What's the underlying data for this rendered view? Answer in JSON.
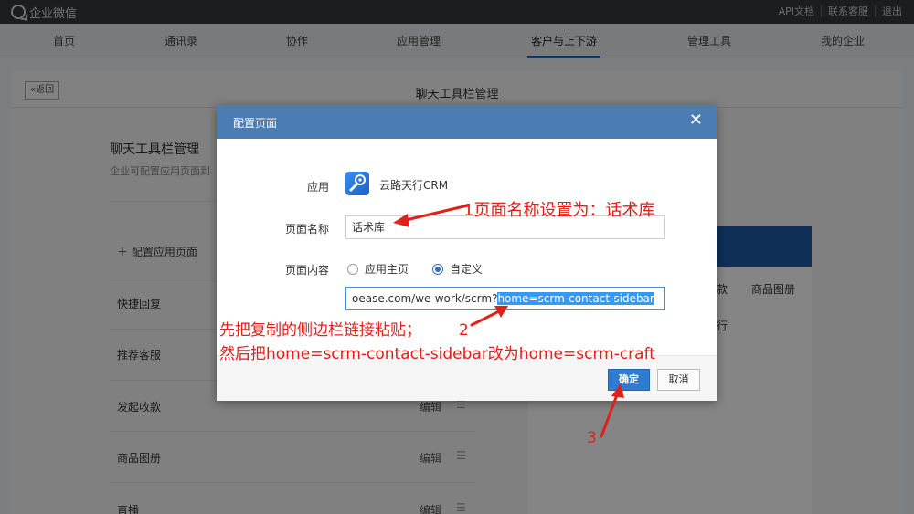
{
  "topbar": {
    "logo_text": "企业微信",
    "links": [
      "API文档",
      "联系客服",
      "退出"
    ]
  },
  "nav": {
    "items": [
      "首页",
      "通讯录",
      "协作",
      "应用管理",
      "客户与上下游",
      "管理工具",
      "我的企业"
    ],
    "active": "客户与上下游"
  },
  "page": {
    "back_label": "返回",
    "title": "聊天工具栏管理"
  },
  "section": {
    "title": "聊天工具栏管理",
    "desc": "企业可配置应用页面到",
    "add_label": "配置应用页面",
    "items": [
      {
        "label": "快捷回复",
        "edit": ""
      },
      {
        "label": "推荐客服",
        "edit": ""
      },
      {
        "label": "发起收款",
        "edit": "编辑"
      },
      {
        "label": "商品图册",
        "edit": "编辑"
      },
      {
        "label": "直播",
        "edit": "编辑"
      }
    ]
  },
  "right_panel": {
    "col1": "款",
    "col2": "商品图册",
    "row_text": "行"
  },
  "dialog": {
    "title": "配置页面",
    "app_label": "应用",
    "app_name": "云路天行CRM",
    "page_name_label": "页面名称",
    "page_name_value": "话术库",
    "page_content_label": "页面内容",
    "radio_home": "应用主页",
    "radio_custom": "自定义",
    "radio_selected": "自定义",
    "url_plain": "oease.com/we-work/scrm?",
    "url_selected": "home=scrm-contact-sidebar",
    "ok_label": "确定",
    "cancel_label": "取消"
  },
  "annotations": {
    "note1": "1页面名称设置为：话术库",
    "note2_line1": "先把复制的侧边栏链接粘贴；",
    "note2_line2": "然后把home=scrm-contact-sidebar改为home=scrm-craft",
    "num2": "2",
    "num3": "3",
    "color": "#e0201a"
  }
}
